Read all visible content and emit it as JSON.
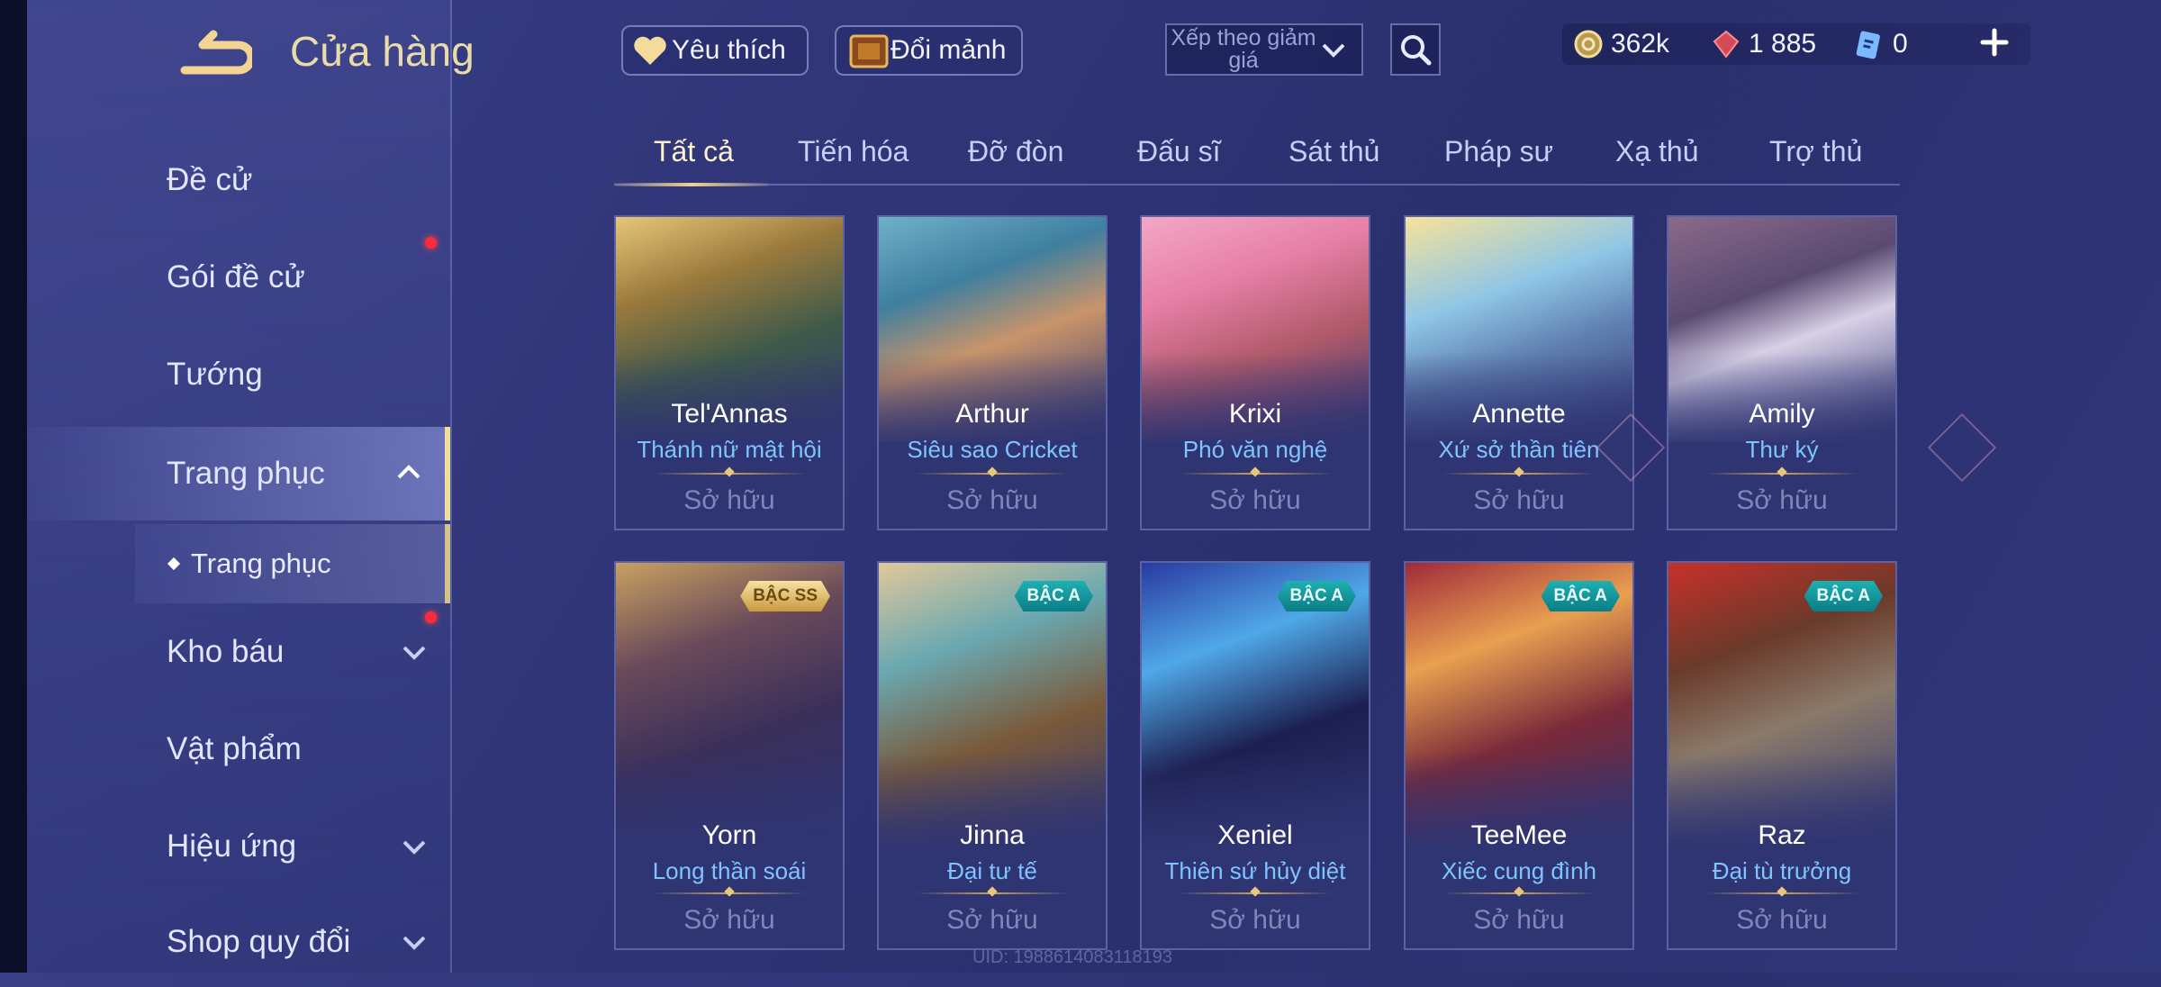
{
  "header": {
    "title": "Cửa hàng",
    "favorite_label": "Yêu thích",
    "exchange_label": "Đổi mảnh",
    "sort_label": "Xếp theo giảm giá",
    "currencies": [
      {
        "icon": "gold-coin-icon",
        "value": "362k"
      },
      {
        "icon": "red-gem-icon",
        "value": "1 885"
      },
      {
        "icon": "voucher-icon",
        "value": "0"
      }
    ]
  },
  "sidebar": {
    "items": [
      {
        "label": "Đề cử"
      },
      {
        "label": "Gói đề cử"
      },
      {
        "label": "Tướng"
      },
      {
        "label": "Trang phục"
      },
      {
        "label": "Kho báu"
      },
      {
        "label": "Vật phẩm"
      },
      {
        "label": "Hiệu ứng"
      },
      {
        "label": "Shop quy đổi"
      }
    ],
    "sub_item": "Trang phục"
  },
  "tabs": [
    "Tất cả",
    "Tiến hóa",
    "Đỡ đòn",
    "Đấu sĩ",
    "Sát thủ",
    "Pháp sư",
    "Xạ thủ",
    "Trợ thủ"
  ],
  "cards": [
    {
      "hero": "Tel'Annas",
      "skin": "Thánh nữ mật hội",
      "status": "Sở hữu",
      "tier": ""
    },
    {
      "hero": "Arthur",
      "skin": "Siêu sao Cricket",
      "status": "Sở hữu",
      "tier": ""
    },
    {
      "hero": "Krixi",
      "skin": "Phó văn nghệ",
      "status": "Sở hữu",
      "tier": ""
    },
    {
      "hero": "Annette",
      "skin": "Xứ sở thần tiên",
      "status": "Sở hữu",
      "tier": ""
    },
    {
      "hero": "Amily",
      "skin": "Thư ký",
      "status": "Sở hữu",
      "tier": ""
    },
    {
      "hero": "Yorn",
      "skin": "Long thần soái",
      "status": "Sở hữu",
      "tier": "BẬC SS"
    },
    {
      "hero": "Jinna",
      "skin": "Đại tư tế",
      "status": "Sở hữu",
      "tier": "BẬC A"
    },
    {
      "hero": "Xeniel",
      "skin": "Thiên sứ hủy diệt",
      "status": "Sở hữu",
      "tier": "BẬC A"
    },
    {
      "hero": "TeeMee",
      "skin": "Xiếc cung đình",
      "status": "Sở hữu",
      "tier": "BẬC A"
    },
    {
      "hero": "Raz",
      "skin": "Đại tù trưởng",
      "status": "Sở hữu",
      "tier": "BẬC A"
    }
  ],
  "uid": "UID: 1988614083118193",
  "colors": {
    "accent_gold": "#f2d38c",
    "skin_name_blue": "#7fc4ff",
    "notification_red": "#ff2a3a",
    "tier_a": "#1fb0b2",
    "tier_ss": "#e6c270"
  }
}
